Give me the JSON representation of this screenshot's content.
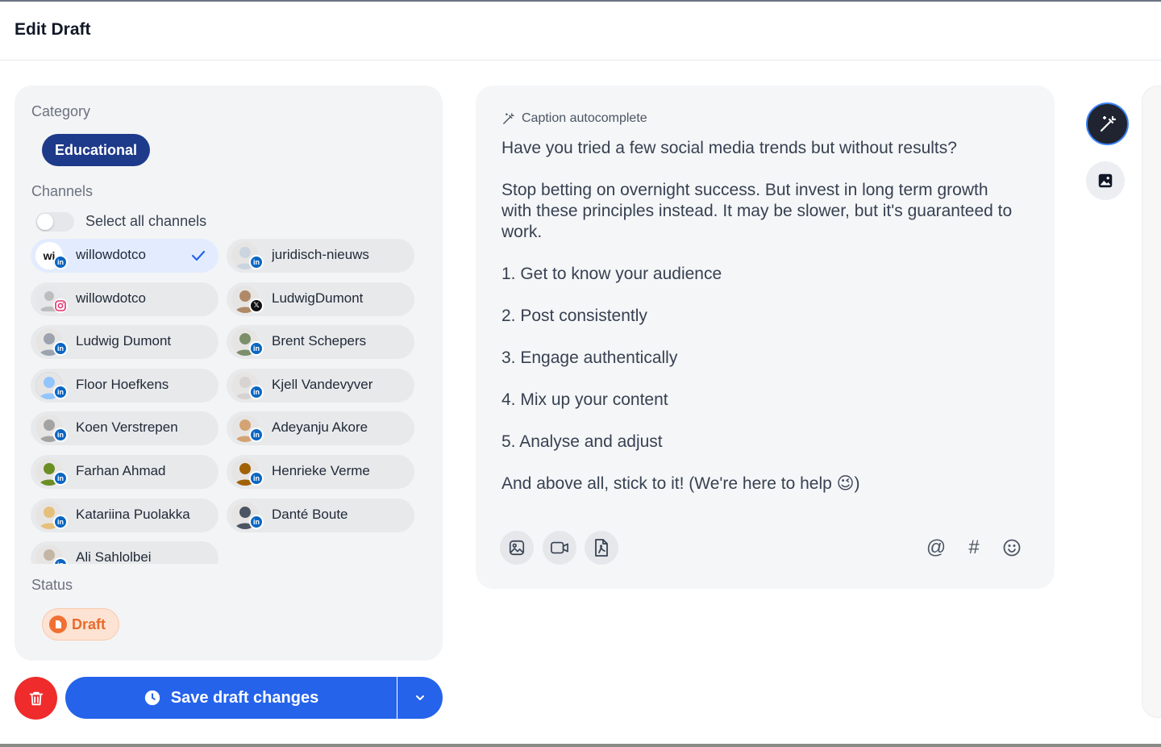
{
  "header": {
    "title": "Edit Draft"
  },
  "category": {
    "label": "Category",
    "selected": "Educational"
  },
  "channels": {
    "label": "Channels",
    "select_all_label": "Select all channels",
    "select_all_on": false,
    "items": [
      {
        "name": "willowdotco",
        "network": "linkedin",
        "selected": true,
        "avatar_text": "wi"
      },
      {
        "name": "juridisch-nieuws",
        "network": "linkedin",
        "selected": false
      },
      {
        "name": "willowdotco",
        "network": "instagram",
        "selected": false
      },
      {
        "name": "LudwigDumont",
        "network": "x",
        "selected": false
      },
      {
        "name": "Ludwig Dumont",
        "network": "linkedin",
        "selected": false
      },
      {
        "name": "Brent Schepers",
        "network": "linkedin",
        "selected": false
      },
      {
        "name": "Floor Hoefkens",
        "network": "linkedin",
        "selected": false
      },
      {
        "name": "Kjell Vandevyver",
        "network": "linkedin",
        "selected": false
      },
      {
        "name": "Koen Verstrepen",
        "network": "linkedin",
        "selected": false
      },
      {
        "name": "Adeyanju Akore",
        "network": "linkedin",
        "selected": false
      },
      {
        "name": "Farhan Ahmad",
        "network": "linkedin",
        "selected": false
      },
      {
        "name": "Henrieke Verme",
        "network": "linkedin",
        "selected": false
      },
      {
        "name": "Katariina Puolakka",
        "network": "linkedin",
        "selected": false
      },
      {
        "name": "Danté Boute",
        "network": "linkedin",
        "selected": false
      },
      {
        "name": "Ali Sahlolbei",
        "network": "linkedin",
        "selected": false
      }
    ]
  },
  "status": {
    "label": "Status",
    "value": "Draft"
  },
  "actions": {
    "save_label": "Save draft changes"
  },
  "editor": {
    "autocomplete_label": "Caption autocomplete",
    "paragraphs": [
      "Have you tried a few social media trends but without results?",
      "Stop betting on overnight success. But invest in long term growth with these principles instead. It may be slower, but it's guaranteed to work.",
      "1. Get to know your audience",
      "2. Post consistently",
      "3. Engage authentically",
      "4. Mix up your content",
      "5. Analyse and adjust",
      "And above all, stick to it! (We're here to help 😉)"
    ],
    "mention_symbol": "@",
    "hashtag_symbol": "#"
  },
  "colors": {
    "primary": "#2563eb",
    "category_chip": "#1e3a8a",
    "danger": "#ef2b2b",
    "draft": "#ea6a2a",
    "linkedin": "#0a66c2"
  },
  "icons": {
    "category": "none",
    "editor_header": "magic-wand-icon",
    "side_top": "magic-wand-icon",
    "side_bottom": "image-icon",
    "delete": "trash-icon",
    "save": "clock-icon",
    "caret": "chevron-down-icon"
  }
}
